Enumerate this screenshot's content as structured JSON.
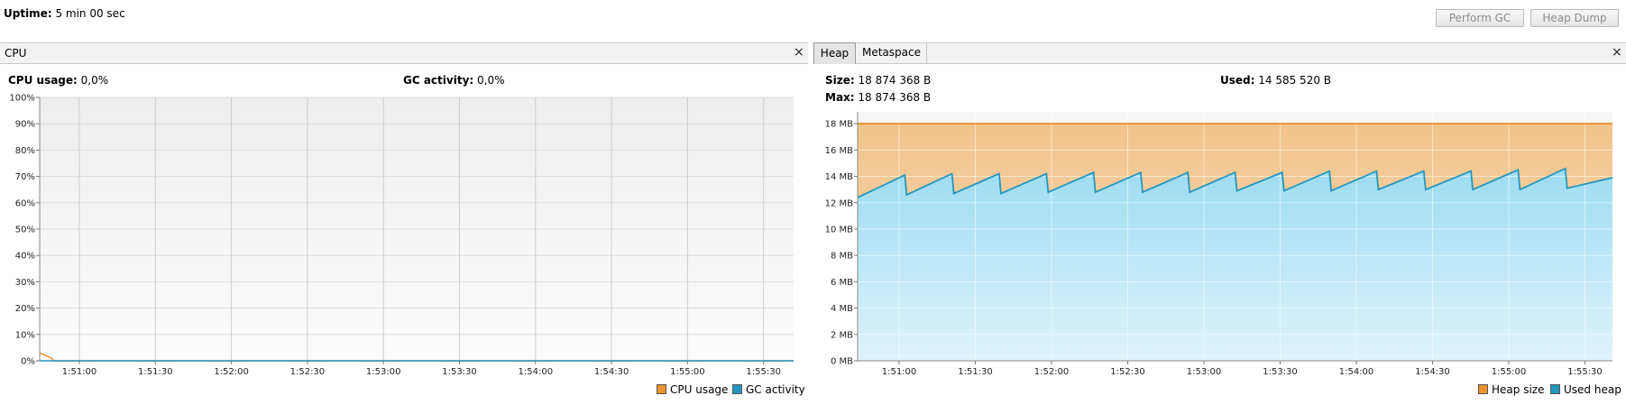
{
  "header": {
    "uptime_label": "Uptime:",
    "uptime_value": "5 min 00 sec",
    "perform_gc_label": "Perform GC",
    "heap_dump_label": "Heap Dump"
  },
  "cpu_panel": {
    "title": "CPU",
    "close_glyph": "×",
    "cpu_usage_label": "CPU usage:",
    "cpu_usage_value": "0,0%",
    "gc_activity_label": "GC activity:",
    "gc_activity_value": "0,0%",
    "legend": [
      {
        "name": "CPU usage",
        "color": "#e8932e"
      },
      {
        "name": "GC activity",
        "color": "#2596be"
      }
    ]
  },
  "heap_panel": {
    "tabs": [
      {
        "label": "Heap",
        "active": true
      },
      {
        "label": "Metaspace",
        "active": false
      }
    ],
    "close_glyph": "×",
    "size_label": "Size:",
    "size_value": "18 874 368 B",
    "used_label": "Used:",
    "used_value": "14 585 520 B",
    "max_label": "Max:",
    "max_value": "18 874 368 B",
    "legend": [
      {
        "name": "Heap size",
        "color": "#e8932e"
      },
      {
        "name": "Used heap",
        "color": "#2596be"
      }
    ]
  },
  "chart_data": [
    {
      "type": "line",
      "ylabels": [
        "0%",
        "10%",
        "20%",
        "30%",
        "40%",
        "50%",
        "60%",
        "70%",
        "80%",
        "90%",
        "100%"
      ],
      "ylim": [
        0,
        100
      ],
      "x_tick_labels": [
        "1:51:00",
        "1:51:30",
        "1:52:00",
        "1:52:30",
        "1:53:00",
        "1:53:30",
        "1:54:00",
        "1:54:30",
        "1:55:00",
        "1:55:30"
      ],
      "grid": true,
      "legend_position": "bottom-right",
      "series": [
        {
          "name": "CPU usage",
          "color": "#e8932e",
          "x_seconds_from_start": [
            0,
            1,
            2,
            5,
            60,
            120,
            180,
            240,
            300
          ],
          "values": [
            3,
            1,
            0,
            0,
            0,
            0,
            0,
            0,
            0
          ]
        },
        {
          "name": "GC activity",
          "color": "#2596be",
          "x_seconds_from_start": [
            0,
            300
          ],
          "values": [
            0,
            0
          ]
        }
      ]
    },
    {
      "type": "area",
      "ylabels": [
        "0 MB",
        "2 MB",
        "4 MB",
        "6 MB",
        "8 MB",
        "10 MB",
        "12 MB",
        "14 MB",
        "16 MB",
        "18 MB"
      ],
      "ylim": [
        0,
        18.9
      ],
      "unit": "MB",
      "x_tick_labels": [
        "1:51:00",
        "1:51:30",
        "1:52:00",
        "1:52:30",
        "1:53:00",
        "1:53:30",
        "1:54:00",
        "1:54:30",
        "1:55:00",
        "1:55:30"
      ],
      "grid": true,
      "legend_position": "bottom-right",
      "series": [
        {
          "name": "Heap size",
          "color": "#e8932e",
          "values": [
            18,
            18
          ]
        },
        {
          "name": "Used heap",
          "color": "#2596be",
          "values": [
            12.4,
            14.1,
            12.6,
            14.2,
            12.7,
            14.2,
            12.7,
            14.2,
            12.8,
            14.3,
            12.8,
            14.3,
            12.8,
            14.3,
            12.8,
            14.3,
            12.9,
            14.3,
            12.9,
            14.4,
            12.9,
            14.4,
            13.0,
            14.4,
            13.0,
            14.4,
            13.0,
            14.5,
            13.0,
            14.6,
            13.1,
            13.9
          ]
        }
      ]
    }
  ]
}
